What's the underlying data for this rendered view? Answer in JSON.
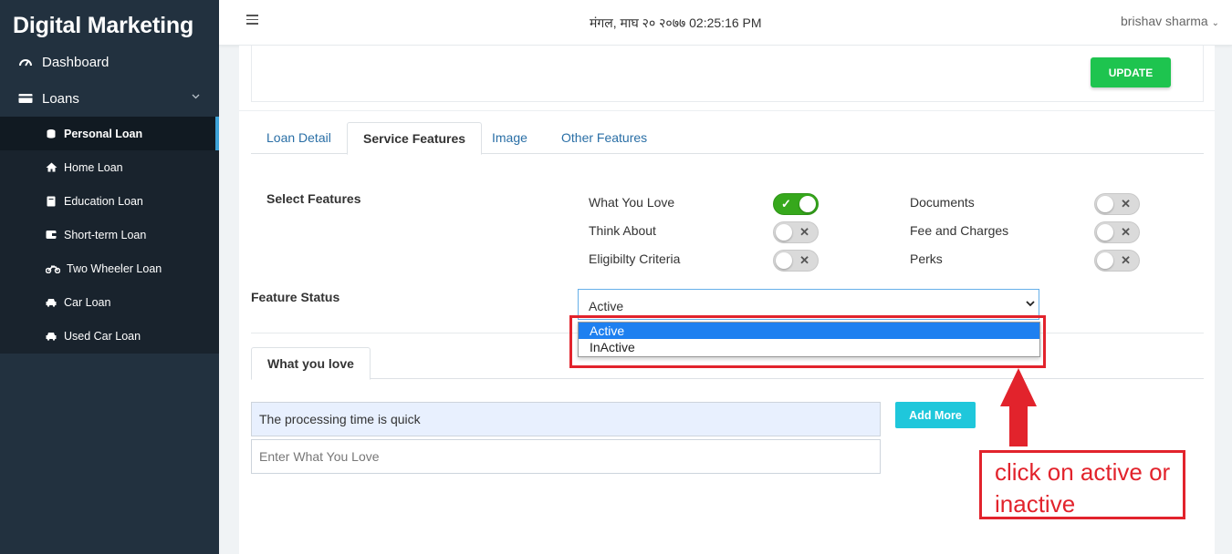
{
  "app": {
    "brand": "Digital Marketing"
  },
  "sidebar": {
    "dashboard": {
      "label": "Dashboard",
      "icon": "dashboard-icon"
    },
    "loans": {
      "label": "Loans",
      "icon": "card-icon"
    },
    "submenu": [
      {
        "label": "Personal Loan",
        "icon": "coins-icon",
        "active": true
      },
      {
        "label": "Home Loan",
        "icon": "home-icon"
      },
      {
        "label": "Education Loan",
        "icon": "book-icon"
      },
      {
        "label": "Short-term Loan",
        "icon": "wallet-icon"
      },
      {
        "label": "Two Wheeler Loan",
        "icon": "motorcycle-icon"
      },
      {
        "label": "Car Loan",
        "icon": "car-icon"
      },
      {
        "label": "Used Car Loan",
        "icon": "car-icon"
      }
    ]
  },
  "header": {
    "date": "मंगल, माघ २० २०७७ 02:25:16 PM",
    "user": "brishav sharma"
  },
  "top_panel": {
    "update_label": "UPDATE"
  },
  "tabs": [
    "Loan Detail",
    "Service Features",
    "Image",
    "Other Features"
  ],
  "features": {
    "label": "Select Features",
    "items": [
      {
        "label": "What You Love",
        "on": true
      },
      {
        "label": "Think About",
        "on": false
      },
      {
        "label": "Eligibilty Criteria",
        "on": false
      },
      {
        "label": "Documents",
        "on": false
      },
      {
        "label": "Fee and Charges",
        "on": false
      },
      {
        "label": "Perks",
        "on": false
      }
    ]
  },
  "status": {
    "label": "Feature Status",
    "value": "Active",
    "options": [
      "Active",
      "InActive"
    ]
  },
  "love_tab": {
    "label": "What you love"
  },
  "love_inputs": {
    "filled_value": "The processing time is quick",
    "placeholder": "Enter What You Love",
    "add_more_label": "Add More"
  },
  "annotation": {
    "text": "click on active or inactive",
    "color": "#e2232c"
  },
  "colors": {
    "sidebar": "#22313f",
    "update": "#1ec44f",
    "add_more": "#1fc7db",
    "toggle_on": "#36a81c",
    "link": "#2a6fa6"
  }
}
